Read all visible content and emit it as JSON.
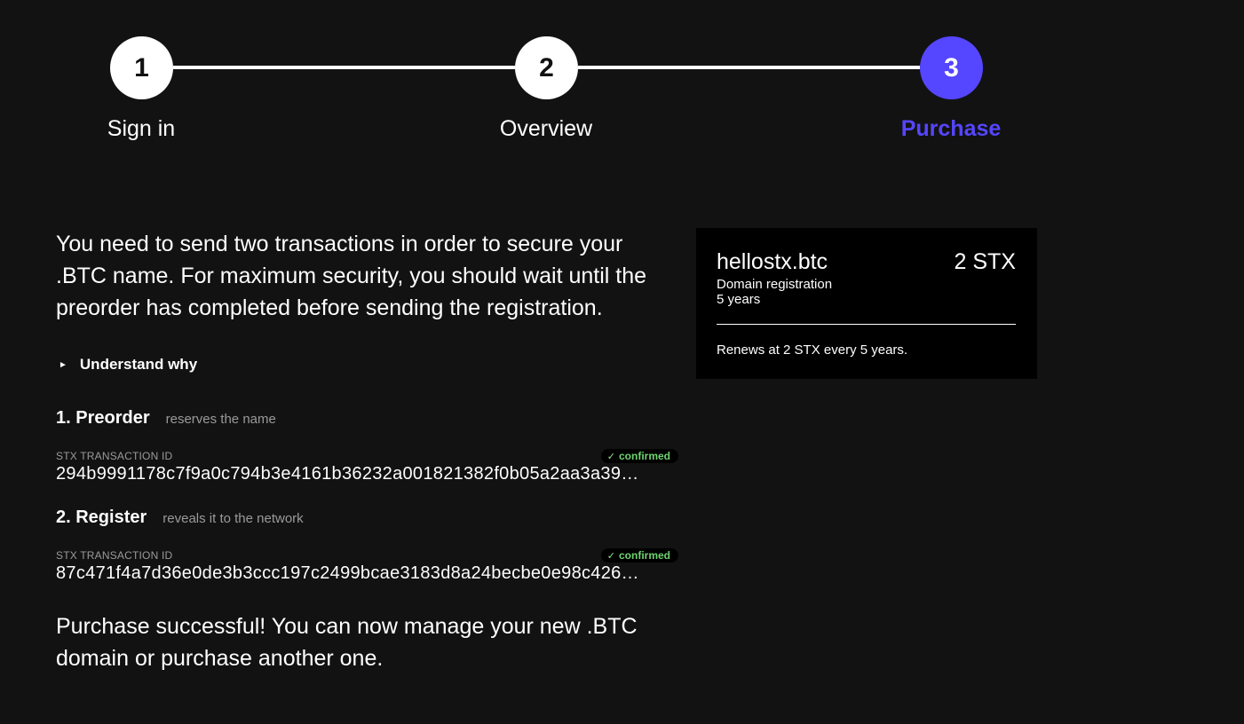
{
  "stepper": {
    "steps": [
      {
        "number": "1",
        "label": "Sign in"
      },
      {
        "number": "2",
        "label": "Overview"
      },
      {
        "number": "3",
        "label": "Purchase"
      }
    ],
    "active_index": 2,
    "active_color": "#5546ff"
  },
  "intro": {
    "text": "You need to send two transactions in order to secure your .BTC name. For maximum security, you should wait until the preorder has completed before sending the registration."
  },
  "disclosure": {
    "label": "Understand why"
  },
  "transactions": [
    {
      "title": "1. Preorder",
      "subtitle": "reserves the name",
      "id_label": "STX TRANSACTION ID",
      "tx_id": "294b9991178c7f9a0c794b3e4161b36232a001821382f0b05a2aa3a39…",
      "status": "confirmed"
    },
    {
      "title": "2. Register",
      "subtitle": "reveals it to the network",
      "id_label": "STX TRANSACTION ID",
      "tx_id": "87c471f4a7d36e0de3b3ccc197c2499bcae3183d8a24becbe0e98c426…",
      "status": "confirmed"
    }
  ],
  "success": {
    "text": "Purchase successful! You can now manage your new .BTC domain or purchase another one."
  },
  "summary": {
    "name": "hellostx.btc",
    "price": "2 STX",
    "type": "Domain registration",
    "duration": "5 years",
    "renewal": "Renews at 2 STX every 5 years."
  },
  "colors": {
    "background": "#121212",
    "card": "#000000",
    "confirmed": "#6ed36e"
  }
}
